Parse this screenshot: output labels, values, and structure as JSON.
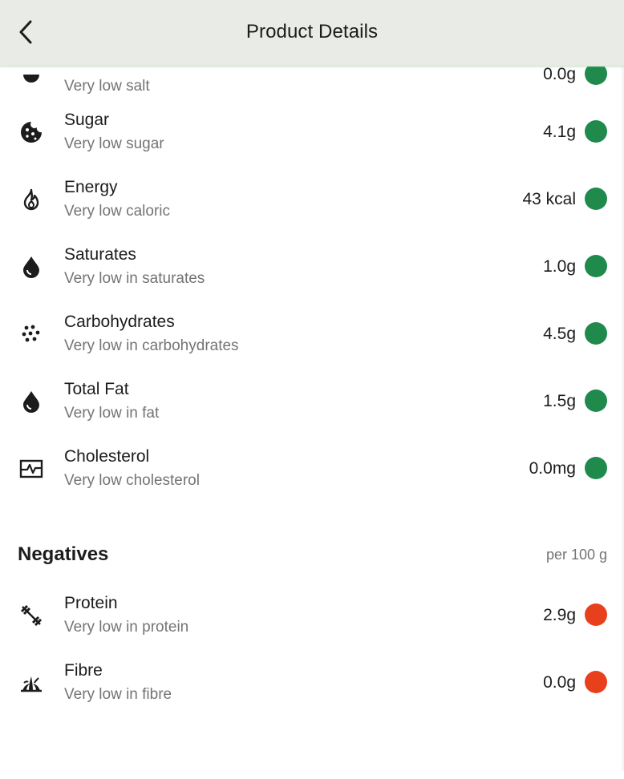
{
  "header": {
    "title": "Product Details"
  },
  "colors": {
    "good": "#1f8a4c",
    "bad": "#e8401c"
  },
  "nutrients": [
    {
      "name": "",
      "desc": "Very low salt",
      "value": "0.0g",
      "status": "good",
      "icon": "salt-icon"
    },
    {
      "name": "Sugar",
      "desc": "Very low sugar",
      "value": "4.1g",
      "status": "good",
      "icon": "cookie-icon"
    },
    {
      "name": "Energy",
      "desc": "Very low caloric",
      "value": "43 kcal",
      "status": "good",
      "icon": "flame-icon"
    },
    {
      "name": "Saturates",
      "desc": "Very low in saturates",
      "value": "1.0g",
      "status": "good",
      "icon": "drop-icon"
    },
    {
      "name": "Carbohydrates",
      "desc": "Very low in carbohydrates",
      "value": "4.5g",
      "status": "good",
      "icon": "grain-dots-icon"
    },
    {
      "name": "Total Fat",
      "desc": "Very low in fat",
      "value": "1.5g",
      "status": "good",
      "icon": "drop-icon"
    },
    {
      "name": "Cholesterol",
      "desc": "Very low cholesterol",
      "value": "0.0mg",
      "status": "good",
      "icon": "heart-monitor-icon"
    }
  ],
  "negatives": {
    "title": "Negatives",
    "note": "per 100 g",
    "items": [
      {
        "name": "Protein",
        "desc": "Very low in protein",
        "value": "2.9g",
        "status": "bad",
        "icon": "dumbbell-icon"
      },
      {
        "name": "Fibre",
        "desc": "Very low in fibre",
        "value": "0.0g",
        "status": "bad",
        "icon": "grass-icon"
      }
    ]
  }
}
